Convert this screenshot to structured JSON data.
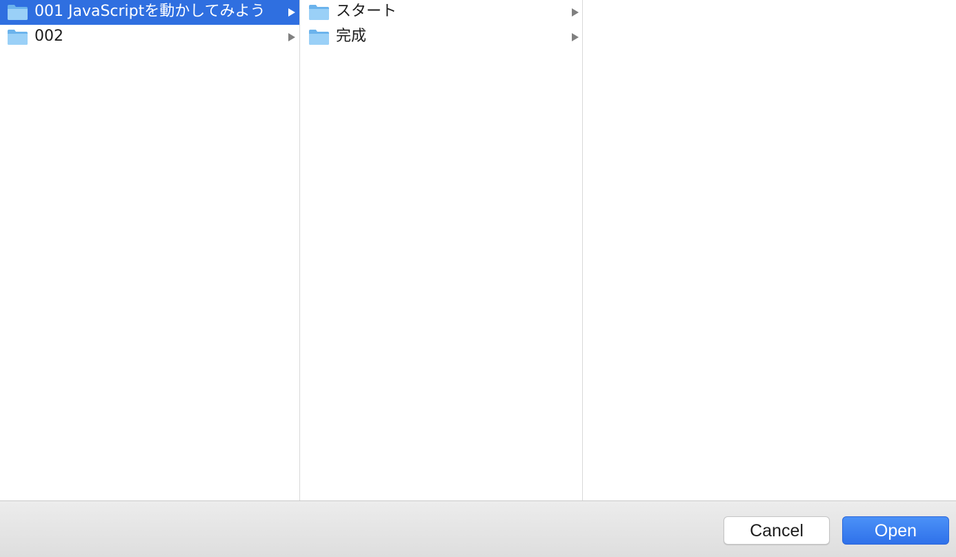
{
  "columns": [
    {
      "items": [
        {
          "label": "001 JavaScriptを動かしてみよう",
          "icon": "folder-icon",
          "selected": true,
          "has_children": true
        },
        {
          "label": "002",
          "icon": "folder-icon",
          "selected": false,
          "has_children": true
        }
      ]
    },
    {
      "items": [
        {
          "label": "スタート",
          "icon": "folder-icon",
          "selected": false,
          "has_children": true
        },
        {
          "label": "完成",
          "icon": "folder-icon",
          "selected": false,
          "has_children": true
        }
      ]
    },
    {
      "items": []
    }
  ],
  "footer": {
    "cancel_label": "Cancel",
    "open_label": "Open"
  },
  "colors": {
    "selection": "#2f6fe0",
    "folder_light": "#9ad0f7",
    "folder_dark": "#6bb3ec",
    "open_button": "#3b82f6"
  }
}
